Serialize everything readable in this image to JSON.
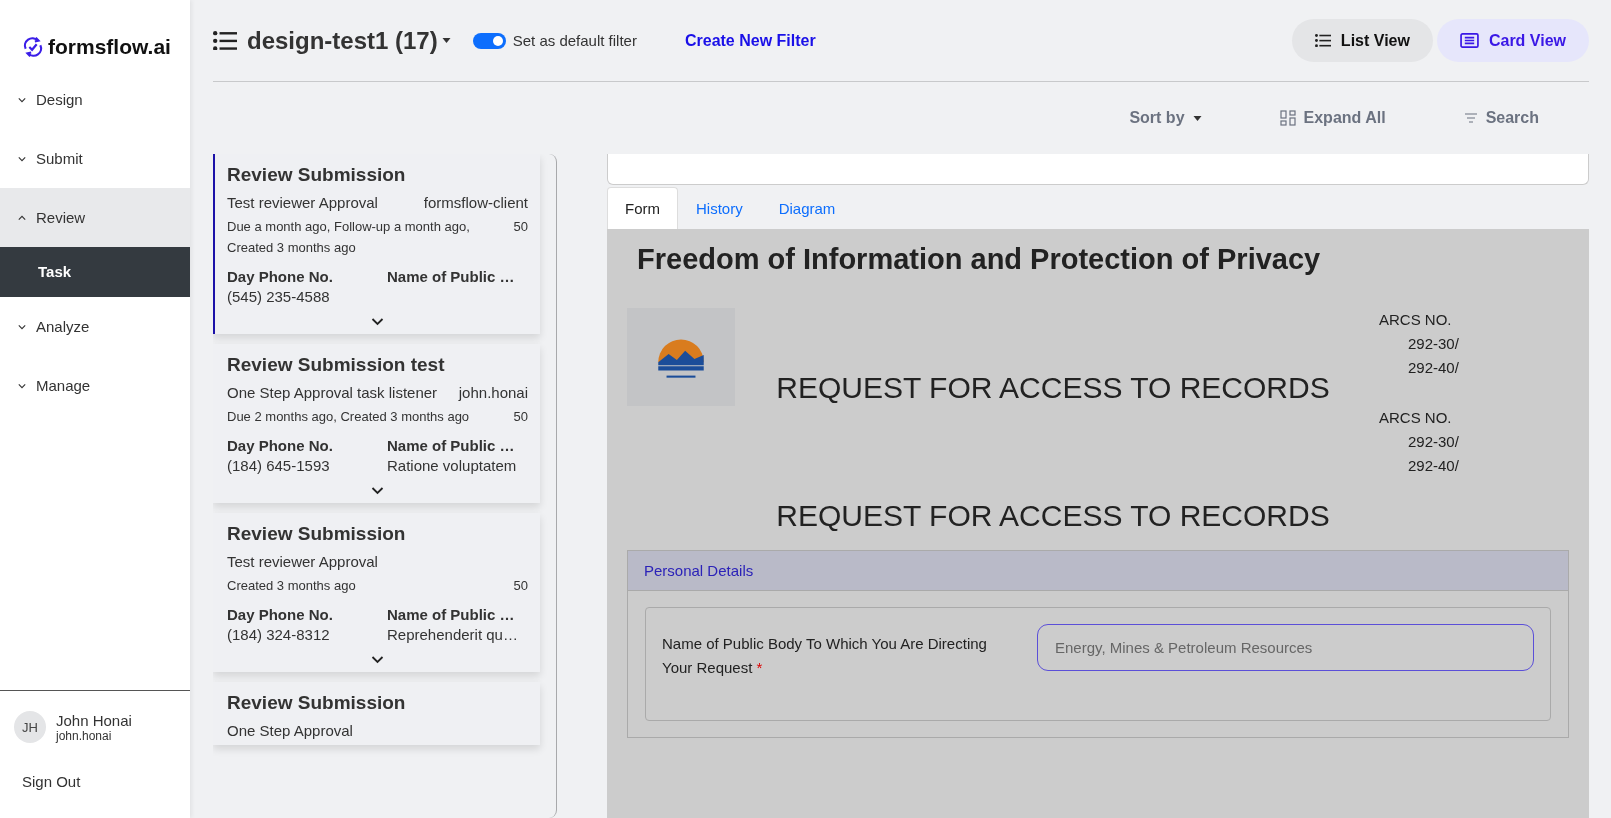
{
  "sidebar": {
    "brand": "formsflow.ai",
    "nav": [
      {
        "label": "Design",
        "expanded": false
      },
      {
        "label": "Submit",
        "expanded": false
      },
      {
        "label": "Review",
        "expanded": true,
        "children": [
          {
            "label": "Task",
            "selected": true
          }
        ]
      },
      {
        "label": "Analyze",
        "expanded": false
      },
      {
        "label": "Manage",
        "expanded": false
      }
    ],
    "user": {
      "initials": "JH",
      "name": "John Honai",
      "username": "john.honai"
    },
    "sign_out": "Sign Out"
  },
  "header": {
    "filter_title": "design-test1 (17)",
    "default_toggle": {
      "label": "Set as default filter",
      "on": true
    },
    "create_filter": "Create New Filter",
    "views": [
      {
        "label": "List View",
        "kind": "list",
        "selected": false
      },
      {
        "label": "Card View",
        "kind": "card",
        "selected": true
      }
    ]
  },
  "toolbar": {
    "sort": "Sort by",
    "expand": "Expand All",
    "search": "Search"
  },
  "tasks": [
    {
      "title": "Review Submission",
      "process": "Test reviewer Approval",
      "assignee": "formsflow-client",
      "dates": "Due a month ago, Follow-up a month ago, Created 3 months ago",
      "priority": "50",
      "selected": true,
      "fields": [
        {
          "label": "Day Phone No.",
          "value": "(545) 235-4588"
        },
        {
          "label": "Name of Public …"
        }
      ]
    },
    {
      "title": "Review Submission test",
      "process": "One Step Approval task listener",
      "assignee": "john.honai",
      "dates": "Due 2 months ago, Created 3 months ago",
      "priority": "50",
      "selected": false,
      "fields": [
        {
          "label": "Day Phone No.",
          "value": "(184) 645-1593"
        },
        {
          "label": "Name of Public …",
          "value": "Ratione voluptatem"
        }
      ]
    },
    {
      "title": "Review Submission",
      "process": "Test reviewer Approval",
      "dates": "Created 3 months ago",
      "priority": "50",
      "selected": false,
      "fields": [
        {
          "label": "Day Phone No.",
          "value": "(184) 324-8312"
        },
        {
          "label": "Name of Public …",
          "value": "Reprehenderit qu…"
        }
      ]
    },
    {
      "title": "Review Submission",
      "process": "One Step Approval",
      "selected": false
    }
  ],
  "detail": {
    "tabs": [
      {
        "label": "Form",
        "selected": true
      },
      {
        "label": "History",
        "selected": false
      },
      {
        "label": "Diagram",
        "selected": false
      }
    ],
    "form": {
      "title": "Freedom of Information and Protection of Privacy",
      "blocks": [
        {
          "logo": true,
          "heading": "REQUEST FOR ACCESS TO RECORDS",
          "arcs_label": "ARCS NO.",
          "arcs_numbers": [
            "292-30/",
            "292-40/"
          ]
        },
        {
          "heading": "REQUEST FOR ACCESS TO RECORDS",
          "arcs_label": "ARCS NO.",
          "arcs_numbers": [
            "292-30/",
            "292-40/"
          ]
        }
      ],
      "panel": {
        "title": "Personal Details",
        "field_label": "Name of Public Body To Which You Are Directing Your Request",
        "required_mark": "*",
        "placeholder": "Energy, Mines & Petroleum Resources"
      }
    }
  }
}
